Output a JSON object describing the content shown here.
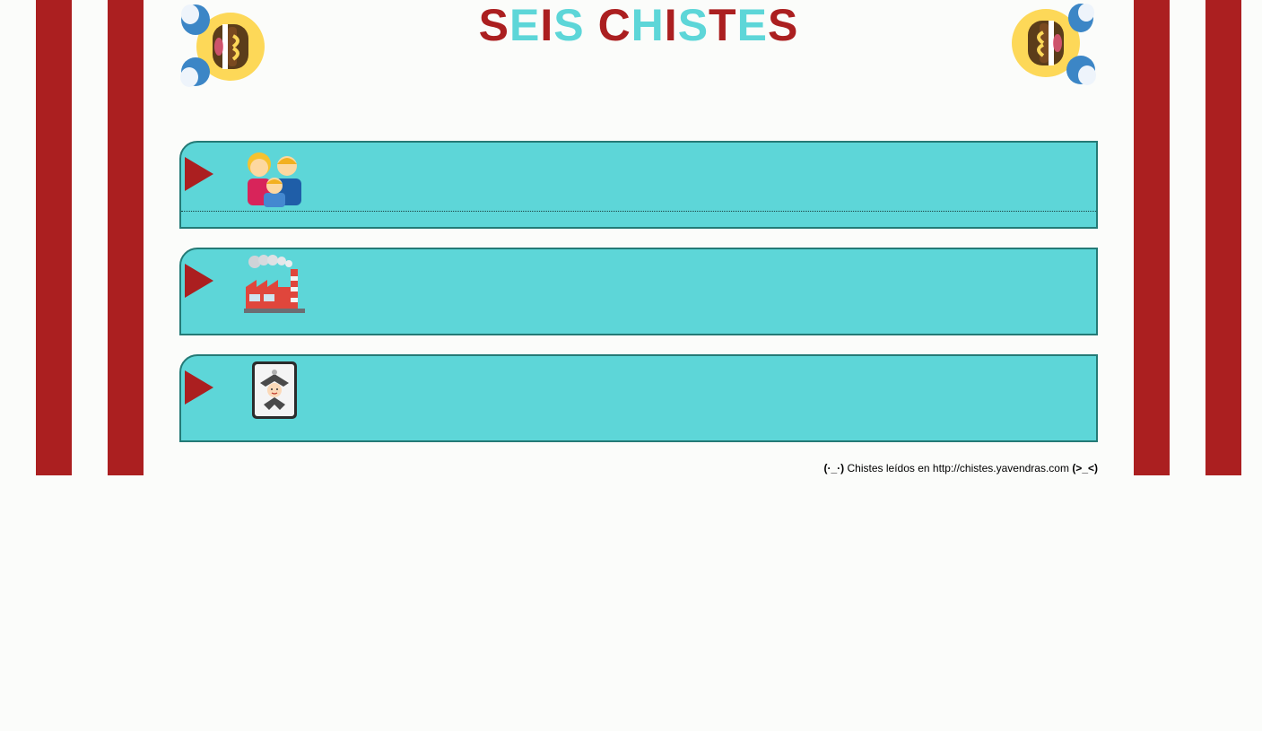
{
  "header": {
    "title_letters": [
      {
        "ch": "S",
        "tone": 0
      },
      {
        "ch": "E",
        "tone": 1
      },
      {
        "ch": "I",
        "tone": 0
      },
      {
        "ch": "S",
        "tone": 1
      },
      {
        "ch": " ",
        "tone": 0
      },
      {
        "ch": "C",
        "tone": 0
      },
      {
        "ch": "H",
        "tone": 1
      },
      {
        "ch": "I",
        "tone": 0
      },
      {
        "ch": "S",
        "tone": 1
      },
      {
        "ch": "T",
        "tone": 0
      },
      {
        "ch": "E",
        "tone": 1
      },
      {
        "ch": "S",
        "tone": 0
      }
    ],
    "left_emoji": "laughing-face-icon",
    "right_emoji": "laughing-face-icon"
  },
  "jokes": [
    {
      "icon": "family-icon"
    },
    {
      "icon": "factory-icon"
    },
    {
      "icon": "joker-card-icon"
    }
  ],
  "footer": {
    "left_face": "(·_·)",
    "text": "Chistes leídos en http://chistes.yavendras.com",
    "right_face": "(>_<)"
  },
  "colors": {
    "stripe": "#ab1f20",
    "accent": "#5dd6d8",
    "border": "#247a76",
    "background": "#fbfcfa"
  }
}
